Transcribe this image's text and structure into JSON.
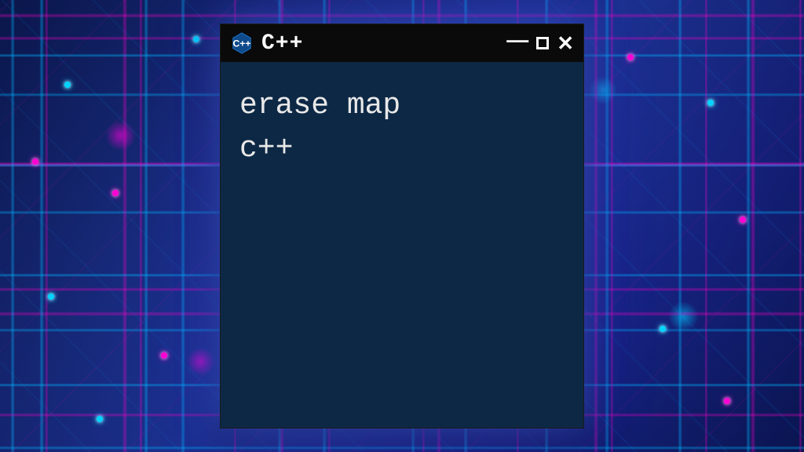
{
  "window": {
    "title": "C++",
    "icon": "cpp-hexagon-icon"
  },
  "terminal": {
    "line1": "erase map",
    "line2": "c++"
  },
  "controls": {
    "minimize": "—",
    "maximize": "",
    "close": "✕"
  }
}
